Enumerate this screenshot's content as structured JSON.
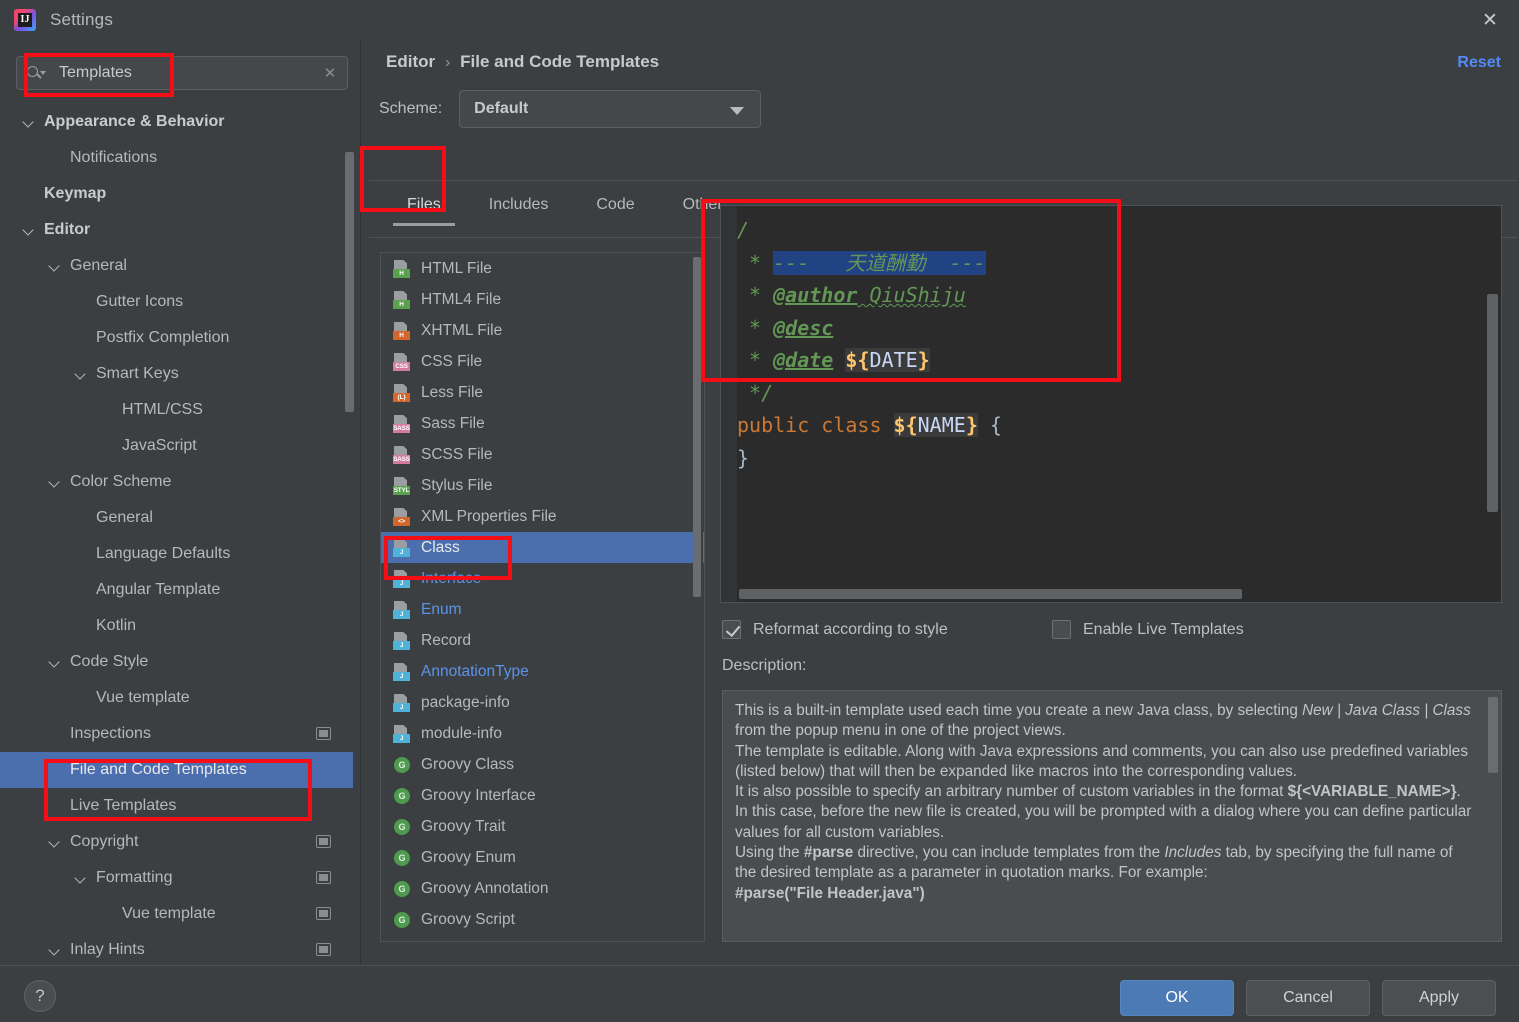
{
  "window": {
    "title": "Settings",
    "app_icon": "intellij-idea-icon",
    "close_icon": "close-icon"
  },
  "sidebar": {
    "search": {
      "value": "Templates",
      "placeholder": "",
      "search_icon": "search-icon",
      "clear_icon": "clear-icon"
    },
    "items": [
      {
        "label": "Appearance & Behavior",
        "indent": 0,
        "chevron": true,
        "bold": true,
        "badge": false,
        "selected": false
      },
      {
        "label": "Notifications",
        "indent": 1,
        "chevron": false,
        "bold": false,
        "badge": false,
        "selected": false
      },
      {
        "label": "Keymap",
        "indent": 0,
        "chevron": false,
        "bold": true,
        "badge": false,
        "selected": false
      },
      {
        "label": "Editor",
        "indent": 0,
        "chevron": true,
        "bold": true,
        "badge": false,
        "selected": false
      },
      {
        "label": "General",
        "indent": 1,
        "chevron": true,
        "bold": false,
        "badge": false,
        "selected": false
      },
      {
        "label": "Gutter Icons",
        "indent": 2,
        "chevron": false,
        "bold": false,
        "badge": false,
        "selected": false
      },
      {
        "label": "Postfix Completion",
        "indent": 2,
        "chevron": false,
        "bold": false,
        "badge": false,
        "selected": false
      },
      {
        "label": "Smart Keys",
        "indent": 2,
        "chevron": true,
        "bold": false,
        "badge": false,
        "selected": false
      },
      {
        "label": "HTML/CSS",
        "indent": 3,
        "chevron": false,
        "bold": false,
        "badge": false,
        "selected": false
      },
      {
        "label": "JavaScript",
        "indent": 3,
        "chevron": false,
        "bold": false,
        "badge": false,
        "selected": false
      },
      {
        "label": "Color Scheme",
        "indent": 1,
        "chevron": true,
        "bold": false,
        "badge": false,
        "selected": false
      },
      {
        "label": "General",
        "indent": 2,
        "chevron": false,
        "bold": false,
        "badge": false,
        "selected": false
      },
      {
        "label": "Language Defaults",
        "indent": 2,
        "chevron": false,
        "bold": false,
        "badge": false,
        "selected": false
      },
      {
        "label": "Angular Template",
        "indent": 2,
        "chevron": false,
        "bold": false,
        "badge": false,
        "selected": false
      },
      {
        "label": "Kotlin",
        "indent": 2,
        "chevron": false,
        "bold": false,
        "badge": false,
        "selected": false
      },
      {
        "label": "Code Style",
        "indent": 1,
        "chevron": true,
        "bold": false,
        "badge": false,
        "selected": false
      },
      {
        "label": "Vue template",
        "indent": 2,
        "chevron": false,
        "bold": false,
        "badge": false,
        "selected": false
      },
      {
        "label": "Inspections",
        "indent": 1,
        "chevron": false,
        "bold": false,
        "badge": true,
        "selected": false
      },
      {
        "label": "File and Code Templates",
        "indent": 1,
        "chevron": false,
        "bold": false,
        "badge": false,
        "selected": true
      },
      {
        "label": "Live Templates",
        "indent": 1,
        "chevron": false,
        "bold": false,
        "badge": false,
        "selected": false
      },
      {
        "label": "Copyright",
        "indent": 1,
        "chevron": true,
        "bold": false,
        "badge": true,
        "selected": false
      },
      {
        "label": "Formatting",
        "indent": 2,
        "chevron": true,
        "bold": false,
        "badge": true,
        "selected": false
      },
      {
        "label": "Vue template",
        "indent": 3,
        "chevron": false,
        "bold": false,
        "badge": true,
        "selected": false
      },
      {
        "label": "Inlay Hints",
        "indent": 1,
        "chevron": true,
        "bold": false,
        "badge": true,
        "selected": false
      }
    ]
  },
  "header": {
    "breadcrumb_parent": "Editor",
    "breadcrumb_sep": "›",
    "breadcrumb_current": "File and Code Templates",
    "reset_label": "Reset",
    "scheme_label": "Scheme:",
    "scheme_value": "Default"
  },
  "tabs": [
    {
      "label": "Files",
      "active": true
    },
    {
      "label": "Includes",
      "active": false
    },
    {
      "label": "Code",
      "active": false
    },
    {
      "label": "Other",
      "active": false
    }
  ],
  "list_toolbar": [
    {
      "name": "add-template-button",
      "icon": "plus-icon"
    },
    {
      "name": "create-from-file-button",
      "icon": "new-file-icon"
    },
    {
      "name": "remove-template-button",
      "icon": "minus-icon"
    },
    {
      "name": "copy-template-button",
      "icon": "copy-icon"
    },
    {
      "name": "reset-template-button",
      "icon": "undo-icon"
    }
  ],
  "file_list": [
    {
      "label": "HTML File",
      "icon": "html-file-icon",
      "tag": "H",
      "tag_color": "#59a14f",
      "style": "normal"
    },
    {
      "label": "HTML4 File",
      "icon": "html4-file-icon",
      "tag": "H",
      "tag_color": "#59a14f",
      "style": "normal"
    },
    {
      "label": "XHTML File",
      "icon": "xhtml-file-icon",
      "tag": "H",
      "tag_color": "#d2662b",
      "style": "normal"
    },
    {
      "label": "CSS File",
      "icon": "css-file-icon",
      "tag": "CSS",
      "tag_color": "#d17ba0",
      "style": "normal"
    },
    {
      "label": "Less File",
      "icon": "less-file-icon",
      "tag": "{L}",
      "tag_color": "#d2662b",
      "style": "normal"
    },
    {
      "label": "Sass File",
      "icon": "sass-file-icon",
      "tag": "SASS",
      "tag_color": "#d17ba0",
      "style": "normal"
    },
    {
      "label": "SCSS File",
      "icon": "scss-file-icon",
      "tag": "SASS",
      "tag_color": "#d17ba0",
      "style": "normal"
    },
    {
      "label": "Stylus File",
      "icon": "stylus-file-icon",
      "tag": "STYL",
      "tag_color": "#59a14f",
      "style": "normal"
    },
    {
      "label": "XML Properties File",
      "icon": "xml-file-icon",
      "tag": "<>",
      "tag_color": "#d2662b",
      "style": "normal"
    },
    {
      "label": "Class",
      "icon": "java-class-icon",
      "tag": "J",
      "tag_color": "#4fb3d9",
      "style": "selected"
    },
    {
      "label": "Interface",
      "icon": "java-iface-icon",
      "tag": "J",
      "tag_color": "#4fb3d9",
      "style": "blue"
    },
    {
      "label": "Enum",
      "icon": "java-enum-icon",
      "tag": "J",
      "tag_color": "#4fb3d9",
      "style": "blue"
    },
    {
      "label": "Record",
      "icon": "java-record-icon",
      "tag": "J",
      "tag_color": "#4fb3d9",
      "style": "normal"
    },
    {
      "label": "AnnotationType",
      "icon": "java-annot-icon",
      "tag": "J",
      "tag_color": "#4fb3d9",
      "style": "blue"
    },
    {
      "label": "package-info",
      "icon": "java-pkg-icon",
      "tag": "J",
      "tag_color": "#4fb3d9",
      "style": "normal"
    },
    {
      "label": "module-info",
      "icon": "java-mod-icon",
      "tag": "J",
      "tag_color": "#4fb3d9",
      "style": "normal"
    },
    {
      "label": "Groovy Class",
      "icon": "groovy-icon",
      "tag": "G",
      "tag_color": "#4e9a4e",
      "style": "normal"
    },
    {
      "label": "Groovy Interface",
      "icon": "groovy-icon",
      "tag": "G",
      "tag_color": "#4e9a4e",
      "style": "normal"
    },
    {
      "label": "Groovy Trait",
      "icon": "groovy-icon",
      "tag": "G",
      "tag_color": "#4e9a4e",
      "style": "normal"
    },
    {
      "label": "Groovy Enum",
      "icon": "groovy-icon",
      "tag": "G",
      "tag_color": "#4e9a4e",
      "style": "normal"
    },
    {
      "label": "Groovy Annotation",
      "icon": "groovy-icon",
      "tag": "G",
      "tag_color": "#4e9a4e",
      "style": "normal"
    },
    {
      "label": "Groovy Script",
      "icon": "groovy-icon",
      "tag": "G",
      "tag_color": "#4e9a4e",
      "style": "normal"
    }
  ],
  "editor": {
    "line1": "/",
    "line2_star": " * ",
    "line2_sel": "---   天道酬勤  ---",
    "line3_star": " * ",
    "line3_tag": "@author",
    "line3_value": " QiuShiju",
    "line4_star": " * ",
    "line4_tag": "@desc",
    "line5_star": " * ",
    "line5_tag": "@date",
    "line5_var": "${DATE}",
    "line6": " */",
    "line7_kw": "public class ",
    "line7_var": "${NAME}",
    "line7_brace": " {",
    "line8": "}"
  },
  "options": {
    "reformat_label": "Reformat according to style",
    "reformat_checked": true,
    "live_templates_label": "Enable Live Templates",
    "live_templates_checked": false,
    "description_label": "Description:"
  },
  "description": {
    "p1a": "This is a built-in template used each time you create a new Java class, by selecting ",
    "p1b": "New | Java Class | Class",
    "p1c": " from the popup menu in one of the project views.",
    "p2": "The template is editable. Along with Java expressions and comments, you can also use predefined variables (listed below) that will then be expanded like macros into the corresponding values.",
    "p3a": "It is also possible to specify an arbitrary number of custom variables in the format ",
    "p3b": "${<VARIABLE_NAME>}",
    "p3c": ". In this case, before the new file is created, you will be prompted with a dialog where you can define particular values for all custom variables.",
    "p4a": "Using the ",
    "p4b": "#parse",
    "p4c": " directive, you can include templates from the ",
    "p4d": "Includes",
    "p4e": " tab, by specifying the full name of the desired template as a parameter in quotation marks. For example:",
    "p5": "#parse(\"File Header.java\")"
  },
  "footer": {
    "help_label": "?",
    "ok_label": "OK",
    "cancel_label": "Cancel",
    "apply_label": "Apply"
  },
  "colors": {
    "accent": "#4b6eaf",
    "link": "#548af7",
    "annotation": "#f50e16",
    "background": "#3c3f41",
    "editor_bg": "#2b2b2b"
  }
}
